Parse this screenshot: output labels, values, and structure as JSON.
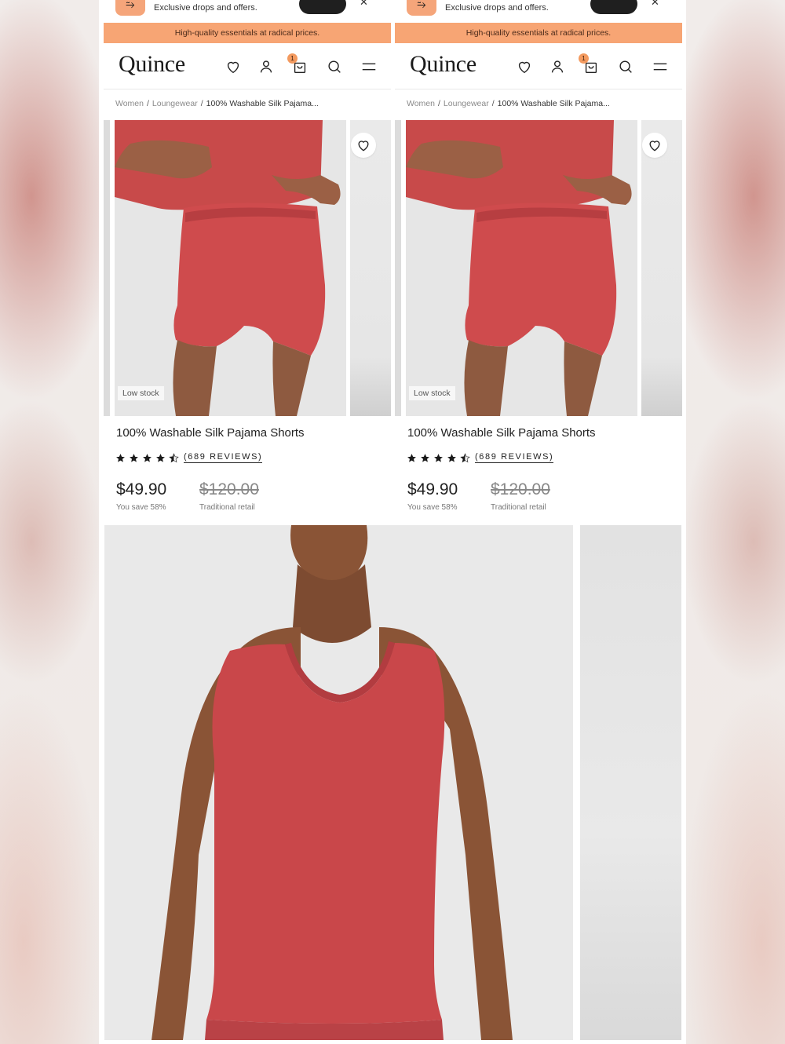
{
  "strip": {
    "text": "Exclusive drops and offers."
  },
  "promo": {
    "text": "High-quality essentials at radical prices."
  },
  "brand": {
    "name": "Quince"
  },
  "header": {
    "cart_count": "1"
  },
  "breadcrumb": {
    "items": [
      "Women",
      "Loungewear",
      "100% Washable Silk Pajama..."
    ]
  },
  "product": {
    "badge": "Low stock",
    "name": "100% Washable Silk Pajama Shorts",
    "rating": 4.5,
    "reviews": "(689 REVIEWS)",
    "price": "$49.90",
    "savings": "You save 58%",
    "retail_price": "$120.00",
    "retail_label": "Traditional retail"
  },
  "icons": [
    "app-logo-icon",
    "close-icon",
    "heart-icon",
    "account-icon",
    "bag-icon",
    "search-icon",
    "menu-icon",
    "star-icon"
  ],
  "colors": {
    "promo_bg": "#f7a574",
    "accent": "#f39a5f",
    "product_red": "#c8454a"
  }
}
